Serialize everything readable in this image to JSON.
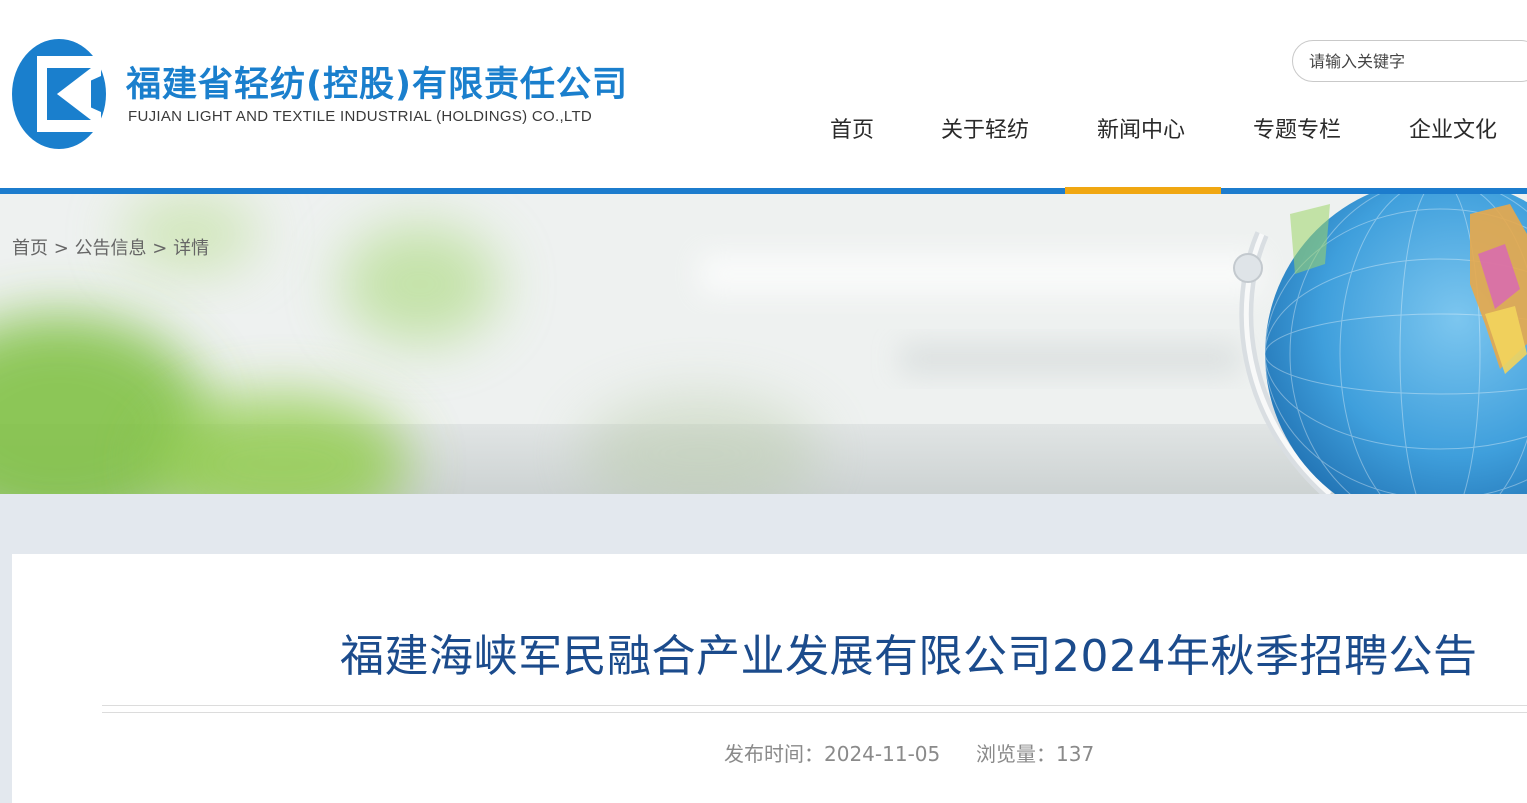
{
  "header": {
    "logo_cn": "福建省轻纺(控股)有限责任公司",
    "logo_en": "FUJIAN LIGHT AND TEXTILE INDUSTRIAL (HOLDINGS) CO.,LTD",
    "search_placeholder": "请输入关键字"
  },
  "nav": {
    "items": [
      {
        "label": "首页"
      },
      {
        "label": "关于轻纺"
      },
      {
        "label": "新闻中心"
      },
      {
        "label": "专题专栏"
      },
      {
        "label": "企业文化"
      }
    ],
    "active_index": 2
  },
  "breadcrumb": {
    "home": "首页",
    "sep": ">",
    "section": "公告信息",
    "current": "详情"
  },
  "article": {
    "title": "福建海峡军民融合产业发展有限公司2024年秋季招聘公告",
    "publish_label": "发布时间：",
    "publish_date": "2024-11-05",
    "views_label": "浏览量：",
    "views": "137"
  },
  "colors": {
    "brand_blue": "#1a7fcd",
    "nav_bar": "#1c7ccd",
    "active_accent": "#f0a712",
    "title_blue": "#1b4b8c"
  }
}
